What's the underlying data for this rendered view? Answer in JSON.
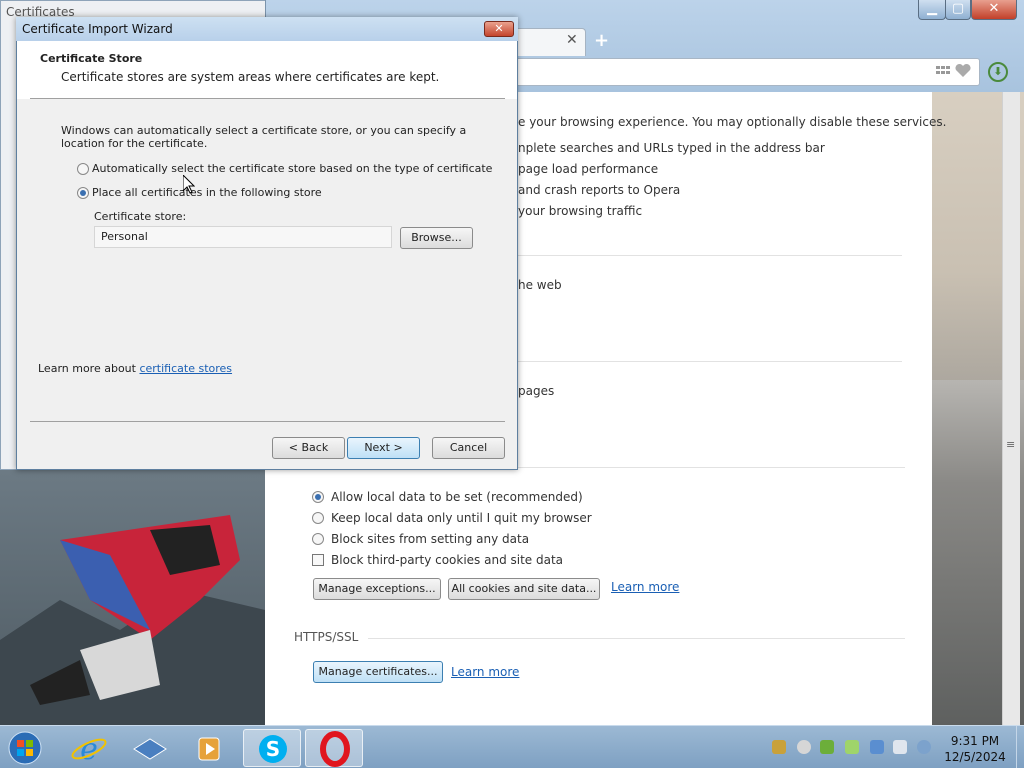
{
  "background_window": {
    "title": "Certificates",
    "close_label": "✕"
  },
  "browser": {
    "new_tab_label": "+",
    "tab_close_label": "✕",
    "window_controls": {
      "minimize": "▁",
      "maximize": "▢",
      "close": "✕"
    },
    "intro_text": "e your browsing experience. You may optionally disable these services.",
    "services": [
      "nplete searches and URLs typed in the address bar",
      "page load performance",
      "and crash reports to Opera",
      "your browsing traffic"
    ],
    "section_web": "he web",
    "section_pages": "pages",
    "cookie_options": [
      {
        "label": "Allow local data to be set (recommended)",
        "checked": true
      },
      {
        "label": "Keep local data only until I quit my browser",
        "checked": false
      },
      {
        "label": "Block sites from setting any data",
        "checked": false
      }
    ],
    "block_third_party_label": "Block third-party cookies and site data",
    "manage_exceptions_label": "Manage exceptions...",
    "all_cookies_label": "All cookies and site data...",
    "learn_more_label": "Learn more",
    "https_heading": "HTTPS/SSL",
    "manage_certificates_label": "Manage certificates...",
    "https_learn_more_label": "Learn more",
    "download_icon": "download-icon"
  },
  "dialog": {
    "title": "Certificate Import Wizard",
    "close_label": "✕",
    "header_title": "Certificate Store",
    "header_subtitle": "Certificate stores are system areas where certificates are kept.",
    "description": "Windows can automatically select a certificate store, or you can specify a location for the certificate.",
    "option_auto": "Automatically select the certificate store based on the type of certificate",
    "option_place": "Place all certificates in the following store",
    "selected_option": "place",
    "store_label": "Certificate store:",
    "store_value": "Personal",
    "browse_label": "Browse...",
    "learn_more_prefix": "Learn more about ",
    "learn_more_link": "certificate stores",
    "back_label": "< Back",
    "next_label": "Next >",
    "cancel_label": "Cancel"
  },
  "taskbar": {
    "apps": [
      "start-orb",
      "internet-explorer",
      "windows-live",
      "media-player",
      "skype",
      "opera"
    ],
    "active_apps": [
      "skype",
      "opera"
    ],
    "time": "9:31 PM",
    "date": "12/5/2024"
  }
}
